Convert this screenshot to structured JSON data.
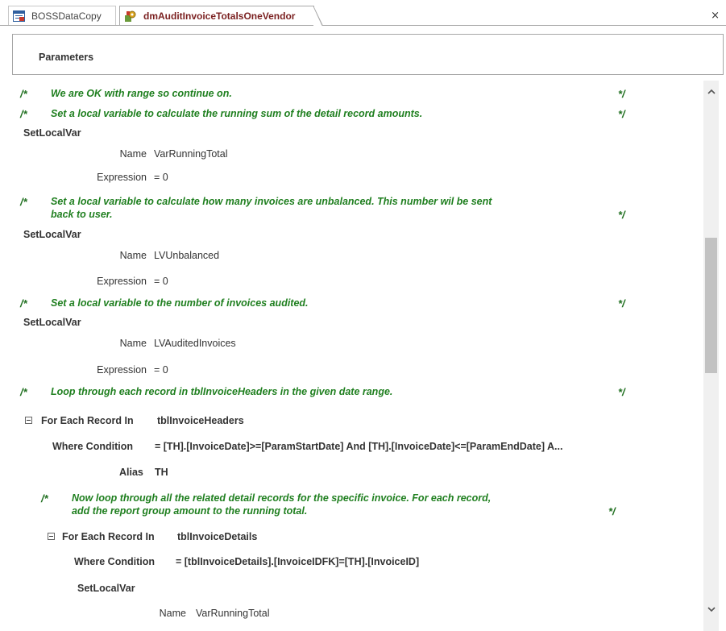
{
  "tabs": [
    {
      "label": "BOSSDataCopy",
      "active": false
    },
    {
      "label": "dmAuditInvoiceTotalsOneVendor",
      "active": true
    }
  ],
  "close_glyph": "×",
  "parameters_label": "Parameters",
  "comment_open": "/*",
  "comment_close": "*/",
  "comments": [
    "We are OK with range so continue on.",
    "Set a local variable to calculate the running sum of the detail record amounts.",
    "Set a local variable to calculate how many invoices are unbalanced. This number wil be sent",
    "back to user.",
    "Set a local variable to the number of invoices audited.",
    "Loop through each record in tblInvoiceHeaders in the given date range.",
    "Now loop through all the related detail records for the specific invoice. For each record,",
    "add the report group amount to the running total."
  ],
  "actions": {
    "set_local_var": "SetLocalVar",
    "for_each": "For Each Record In"
  },
  "arg_labels": {
    "name": "Name",
    "expression": "Expression",
    "where": "Where Condition",
    "alias": "Alias"
  },
  "values": {
    "var1_name": "VarRunningTotal",
    "var1_expr": "= 0",
    "var2_name": "LVUnbalanced",
    "var2_expr": "= 0",
    "var3_name": "LVAuditedInvoices",
    "var3_expr": "= 0",
    "loop1_table": "tblInvoiceHeaders",
    "loop1_where": "= [TH].[InvoiceDate]>=[ParamStartDate] And [TH].[InvoiceDate]<=[ParamEndDate] A...",
    "loop1_alias": "TH",
    "loop2_table": "tblInvoiceDetails",
    "loop2_where": "= [tblInvoiceDetails].[InvoiceIDFK]=[TH].[InvoiceID]",
    "var4_name": "VarRunningTotal"
  },
  "scroll_up": "^",
  "scroll_down": "v",
  "colors": {
    "comment": "#1f7f1f",
    "tab_active_text": "#7a1f1f",
    "scroll_thumb": "#c2c2c2"
  },
  "icons": [
    "table-icon",
    "macro-icon",
    "close-icon",
    "collapse-icon",
    "chevron-up-icon",
    "chevron-down-icon"
  ]
}
